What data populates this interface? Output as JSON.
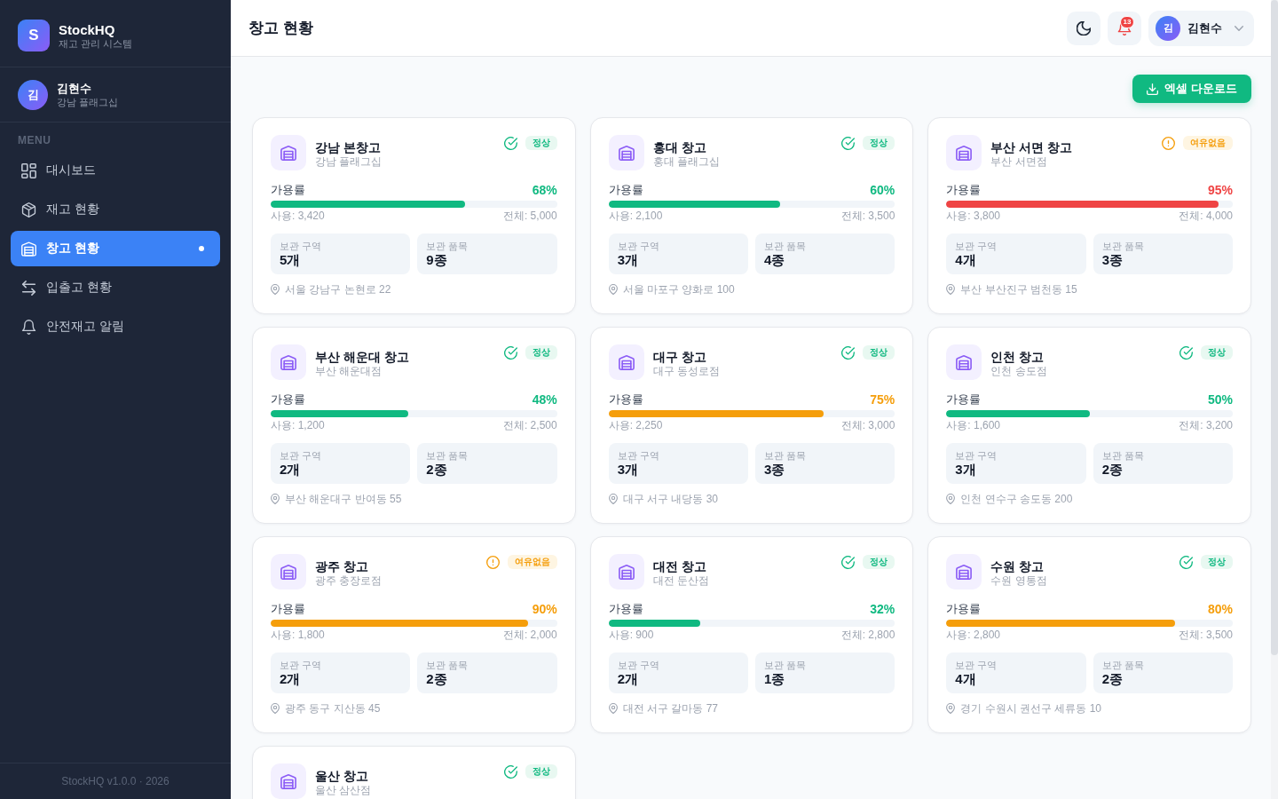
{
  "sidebar": {
    "brand": {
      "logo_letter": "S",
      "name": "StockHQ",
      "subtitle": "재고 관리 시스템"
    },
    "user": {
      "initial": "김",
      "name": "김현수",
      "branch": "강남 플래그십"
    },
    "menu_title": "MENU",
    "items": [
      {
        "kind": "dashboard",
        "label": "대시보드",
        "selected": false
      },
      {
        "kind": "inventory",
        "label": "재고 현황",
        "selected": false
      },
      {
        "kind": "warehouse",
        "label": "창고 현황",
        "selected": true
      },
      {
        "kind": "transactions",
        "label": "입출고 현황",
        "selected": false
      },
      {
        "kind": "alerts",
        "label": "안전재고 알림",
        "selected": false
      }
    ],
    "footer": "StockHQ v1.0.0 · 2026"
  },
  "header": {
    "title": "창고 현황",
    "notifications": "13",
    "user": {
      "initial": "김",
      "name": "김현수"
    }
  },
  "toolbar": {
    "download_button": "엑셀 다운로드"
  },
  "warehouses": [
    {
      "name": "강남 본창고",
      "branch": "강남 플래그십",
      "status": {
        "kind": "ok",
        "label": "정상"
      },
      "capacity": {
        "label": "가용률",
        "percent": "68%",
        "level": 0.68,
        "used": "사용: 3,420",
        "total": "전체: 5,000"
      },
      "stats": [
        {
          "label": "보관 구역",
          "value": "5개"
        },
        {
          "label": "보관 품목",
          "value": "9종"
        }
      ],
      "address": "서울 강남구 논현로 22"
    },
    {
      "name": "홍대 창고",
      "branch": "홍대 플래그십",
      "status": {
        "kind": "ok",
        "label": "정상"
      },
      "capacity": {
        "label": "가용률",
        "percent": "60%",
        "level": 0.6,
        "used": "사용: 2,100",
        "total": "전체: 3,500"
      },
      "stats": [
        {
          "label": "보관 구역",
          "value": "3개"
        },
        {
          "label": "보관 품목",
          "value": "4종"
        }
      ],
      "address": "서울 마포구 양화로 100"
    },
    {
      "name": "부산 서면 창고",
      "branch": "부산 서면점",
      "status": {
        "kind": "warning",
        "label": "여유없음"
      },
      "capacity": {
        "label": "가용률",
        "percent": "95%",
        "level": 0.95,
        "used": "사용: 3,800",
        "total": "전체: 4,000"
      },
      "stats": [
        {
          "label": "보관 구역",
          "value": "4개"
        },
        {
          "label": "보관 품목",
          "value": "3종"
        }
      ],
      "address": "부산 부산진구 범천동 15"
    },
    {
      "name": "부산 해운대 창고",
      "branch": "부산 해운대점",
      "status": {
        "kind": "ok",
        "label": "정상"
      },
      "capacity": {
        "label": "가용률",
        "percent": "48%",
        "level": 0.48,
        "used": "사용: 1,200",
        "total": "전체: 2,500"
      },
      "stats": [
        {
          "label": "보관 구역",
          "value": "2개"
        },
        {
          "label": "보관 품목",
          "value": "2종"
        }
      ],
      "address": "부산 해운대구 반여동 55"
    },
    {
      "name": "대구 창고",
      "branch": "대구 동성로점",
      "status": {
        "kind": "ok",
        "label": "정상"
      },
      "capacity": {
        "label": "가용률",
        "percent": "75%",
        "level": 0.75,
        "used": "사용: 2,250",
        "total": "전체: 3,000"
      },
      "stats": [
        {
          "label": "보관 구역",
          "value": "3개"
        },
        {
          "label": "보관 품목",
          "value": "3종"
        }
      ],
      "address": "대구 서구 내당동 30"
    },
    {
      "name": "인천 창고",
      "branch": "인천 송도점",
      "status": {
        "kind": "ok",
        "label": "정상"
      },
      "capacity": {
        "label": "가용률",
        "percent": "50%",
        "level": 0.5,
        "used": "사용: 1,600",
        "total": "전체: 3,200"
      },
      "stats": [
        {
          "label": "보관 구역",
          "value": "3개"
        },
        {
          "label": "보관 품목",
          "value": "2종"
        }
      ],
      "address": "인천 연수구 송도동 200"
    },
    {
      "name": "광주 창고",
      "branch": "광주 충장로점",
      "status": {
        "kind": "warning",
        "label": "여유없음"
      },
      "capacity": {
        "label": "가용률",
        "percent": "90%",
        "level": 0.9,
        "used": "사용: 1,800",
        "total": "전체: 2,000"
      },
      "stats": [
        {
          "label": "보관 구역",
          "value": "2개"
        },
        {
          "label": "보관 품목",
          "value": "2종"
        }
      ],
      "address": "광주 동구 지산동 45"
    },
    {
      "name": "대전 창고",
      "branch": "대전 둔산점",
      "status": {
        "kind": "ok",
        "label": "정상"
      },
      "capacity": {
        "label": "가용률",
        "percent": "32%",
        "level": 0.32,
        "used": "사용: 900",
        "total": "전체: 2,800"
      },
      "stats": [
        {
          "label": "보관 구역",
          "value": "2개"
        },
        {
          "label": "보관 품목",
          "value": "1종"
        }
      ],
      "address": "대전 서구 갈마동 77"
    },
    {
      "name": "수원 창고",
      "branch": "수원 영통점",
      "status": {
        "kind": "ok",
        "label": "정상"
      },
      "capacity": {
        "label": "가용률",
        "percent": "80%",
        "level": 0.8,
        "used": "사용: 2,800",
        "total": "전체: 3,500"
      },
      "stats": [
        {
          "label": "보관 구역",
          "value": "4개"
        },
        {
          "label": "보관 품목",
          "value": "2종"
        }
      ],
      "address": "경기 수원시 권선구 세류동 10"
    },
    {
      "name": "울산 창고",
      "branch": "울산 삼산점",
      "status": {
        "kind": "ok",
        "label": "정상"
      }
    }
  ]
}
